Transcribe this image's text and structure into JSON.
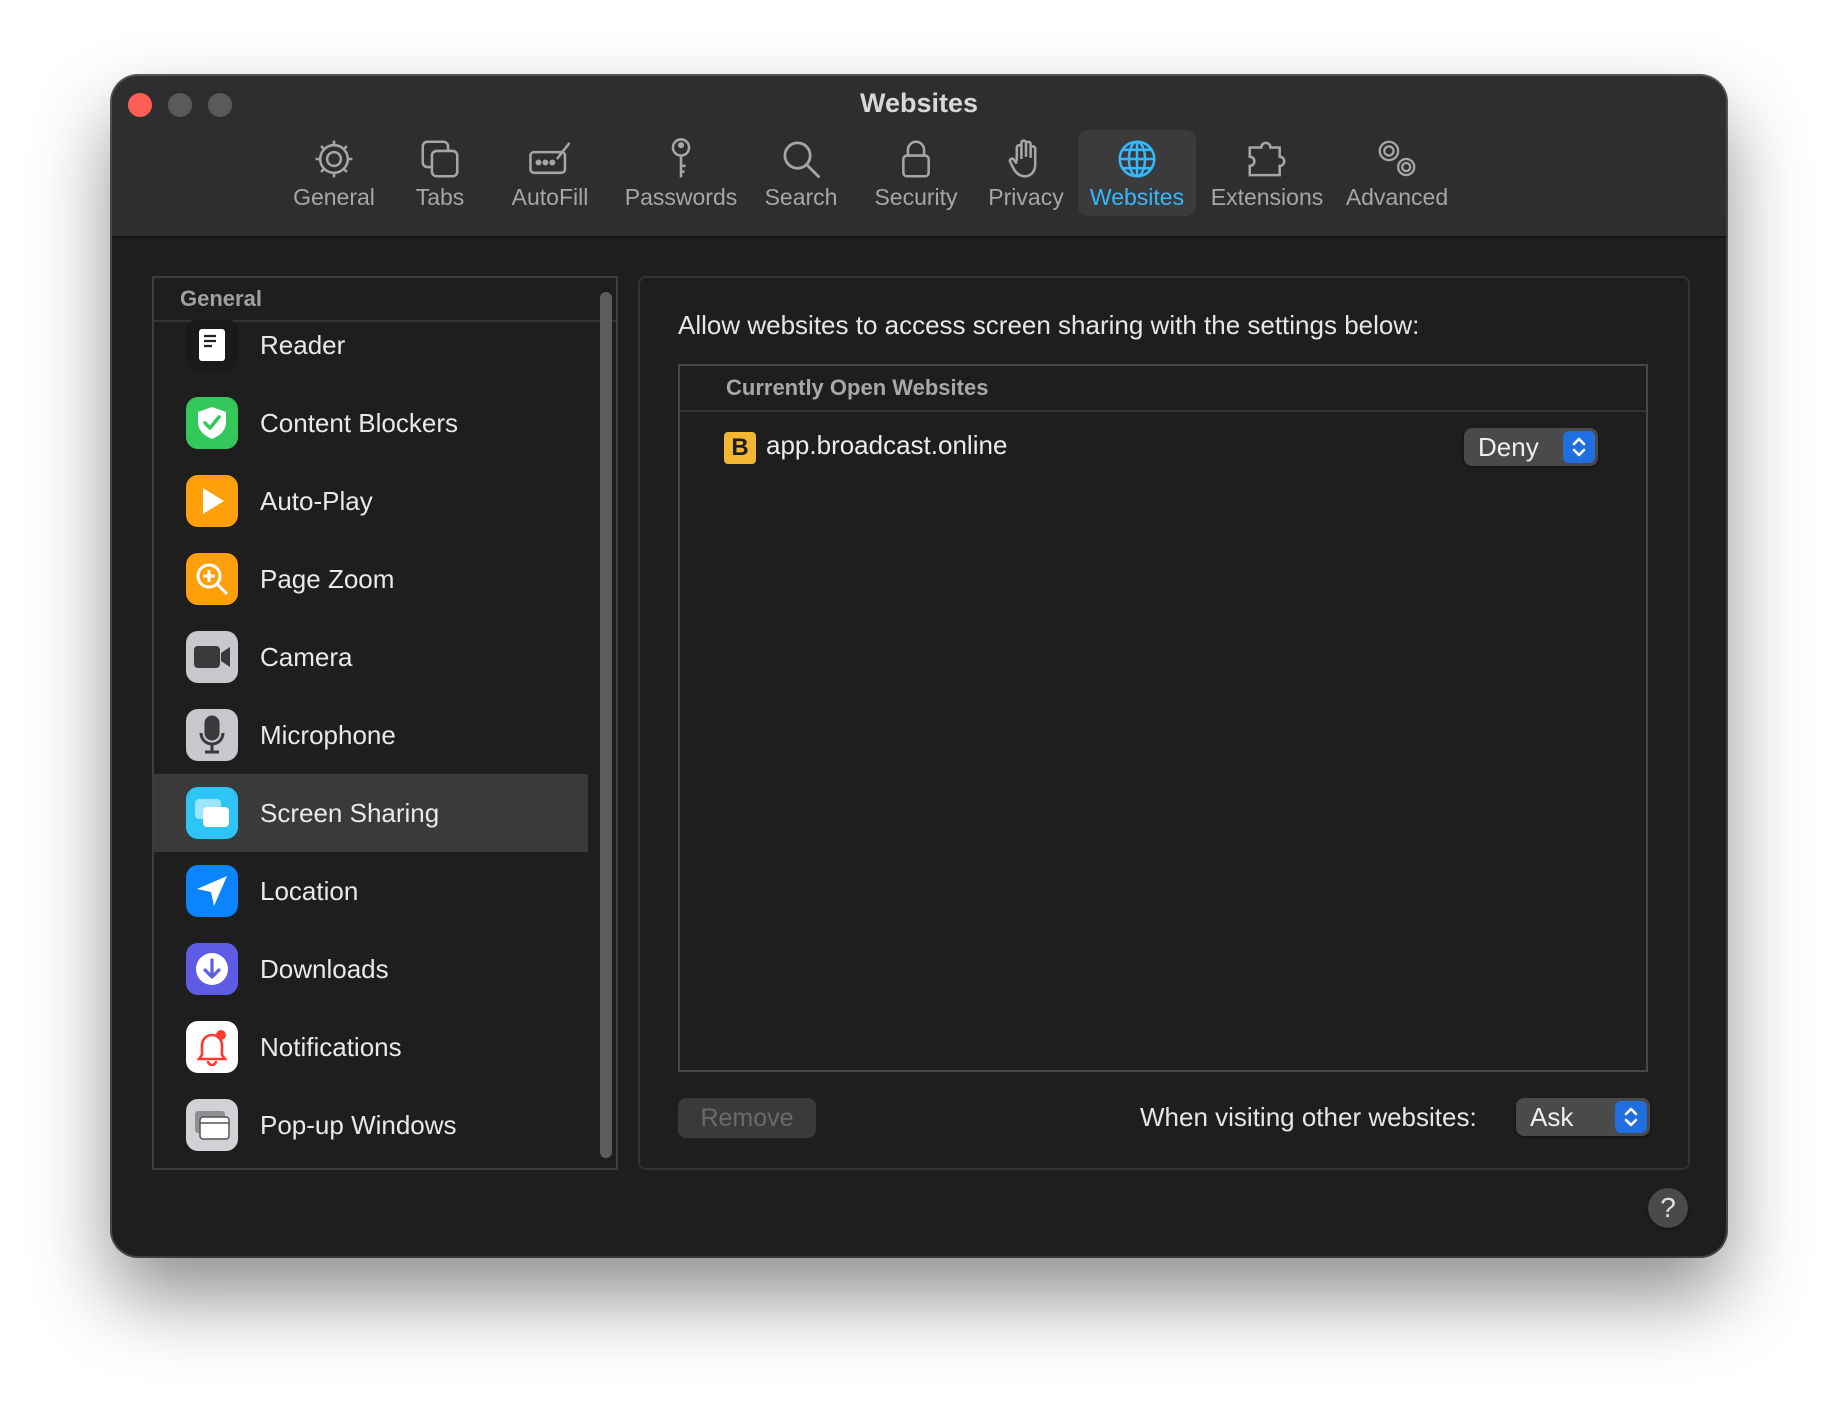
{
  "window": {
    "title": "Websites"
  },
  "toolbar": {
    "items": [
      {
        "label": "General",
        "icon": "gear-icon"
      },
      {
        "label": "Tabs",
        "icon": "tabs-icon"
      },
      {
        "label": "AutoFill",
        "icon": "autofill-icon"
      },
      {
        "label": "Passwords",
        "icon": "key-icon"
      },
      {
        "label": "Search",
        "icon": "magnifier-icon"
      },
      {
        "label": "Security",
        "icon": "lock-icon"
      },
      {
        "label": "Privacy",
        "icon": "hand-icon"
      },
      {
        "label": "Websites",
        "icon": "globe-icon",
        "active": true
      },
      {
        "label": "Extensions",
        "icon": "puzzle-icon"
      },
      {
        "label": "Advanced",
        "icon": "gears-icon"
      }
    ]
  },
  "sidebar": {
    "header": "General",
    "items": [
      {
        "label": "Reader",
        "icon": "reader-icon",
        "color": "#ffffff"
      },
      {
        "label": "Content Blockers",
        "icon": "shield-check-icon",
        "color": "#34c759"
      },
      {
        "label": "Auto-Play",
        "icon": "play-icon",
        "color": "#ff9f0a"
      },
      {
        "label": "Page Zoom",
        "icon": "zoom-icon",
        "color": "#ff9f0a"
      },
      {
        "label": "Camera",
        "icon": "camera-icon",
        "color": "#8e8e93"
      },
      {
        "label": "Microphone",
        "icon": "microphone-icon",
        "color": "#8e8e93"
      },
      {
        "label": "Screen Sharing",
        "icon": "screen-sharing-icon",
        "color": "#2ec4f5",
        "selected": true
      },
      {
        "label": "Location",
        "icon": "location-arrow-icon",
        "color": "#0a84ff"
      },
      {
        "label": "Downloads",
        "icon": "download-icon",
        "color": "#5e5ce6"
      },
      {
        "label": "Notifications",
        "icon": "bell-icon",
        "color": "#ffffff"
      },
      {
        "label": "Pop-up Windows",
        "icon": "popup-window-icon",
        "color": "#d1d1d6"
      }
    ]
  },
  "main": {
    "description": "Allow websites to access screen sharing with the settings below:",
    "table_header": "Currently Open Websites",
    "sites": [
      {
        "favicon_letter": "B",
        "name": "app.broadcast.online",
        "setting": "Deny"
      }
    ],
    "remove_label": "Remove",
    "other_label": "When visiting other websites:",
    "other_value": "Ask"
  },
  "help": {
    "label": "?"
  },
  "colors": {
    "accent": "#34b8ff",
    "popup_accent": "#1f6fe0",
    "favicon": "#f2b632"
  }
}
